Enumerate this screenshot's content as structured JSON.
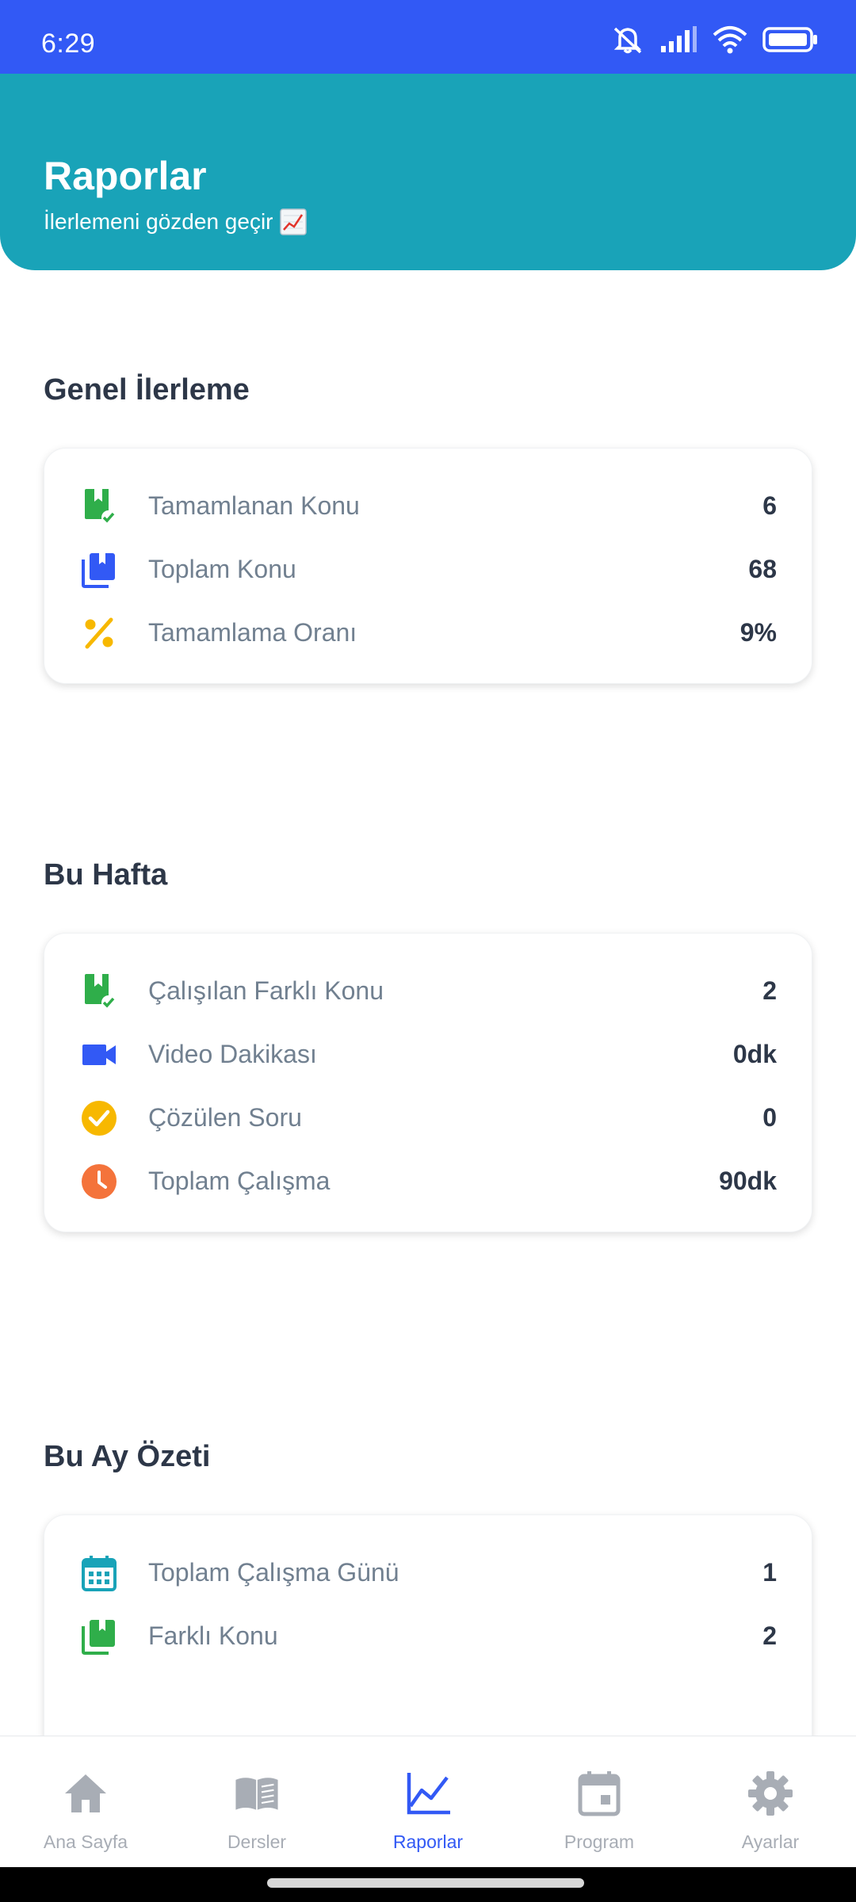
{
  "status_bar": {
    "time": "6:29"
  },
  "header": {
    "title": "Raporlar",
    "subtitle": "İlerlemeni gözden geçir",
    "subtitle_icon": "chart-increasing-emoji"
  },
  "sections": {
    "general": {
      "title": "Genel İlerleme",
      "rows": [
        {
          "label": "Tamamlanan Konu",
          "value": "6",
          "icon": "book-check-icon",
          "color": "#2fae4a"
        },
        {
          "label": "Toplam Konu",
          "value": "68",
          "icon": "library-books-icon",
          "color": "#3259f5"
        },
        {
          "label": "Tamamlama Oranı",
          "value": "9%",
          "icon": "percent-icon",
          "color": "#f7b800"
        }
      ]
    },
    "week": {
      "title": "Bu Hafta",
      "rows": [
        {
          "label": "Çalışılan Farklı Konu",
          "value": "2",
          "icon": "book-check-icon",
          "color": "#2fae4a"
        },
        {
          "label": "Video Dakikası",
          "value": "0dk",
          "icon": "video-camera-icon",
          "color": "#3259f5"
        },
        {
          "label": "Çözülen Soru",
          "value": "0",
          "icon": "check-circle-icon",
          "color": "#f7b800"
        },
        {
          "label": "Toplam Çalışma",
          "value": "90dk",
          "icon": "clock-icon",
          "color": "#f4733b"
        }
      ]
    },
    "month": {
      "title": "Bu Ay Özeti",
      "rows": [
        {
          "label": "Toplam Çalışma Günü",
          "value": "1",
          "icon": "calendar-icon",
          "color": "#19a3b8"
        },
        {
          "label": "Farklı Konu",
          "value": "2",
          "icon": "book-icon",
          "color": "#2fae4a"
        }
      ]
    }
  },
  "bottom_nav": [
    {
      "label": "Ana Sayfa",
      "icon": "home-icon",
      "active": false
    },
    {
      "label": "Dersler",
      "icon": "open-book-icon",
      "active": false
    },
    {
      "label": "Raporlar",
      "icon": "line-chart-icon",
      "active": true
    },
    {
      "label": "Program",
      "icon": "calendar-icon",
      "active": false
    },
    {
      "label": "Ayarlar",
      "icon": "gear-icon",
      "active": false
    }
  ],
  "colors": {
    "status_bar": "#3259f5",
    "header": "#19a3b8",
    "active_nav": "#3259f5",
    "inactive_nav": "#a8adb5"
  }
}
